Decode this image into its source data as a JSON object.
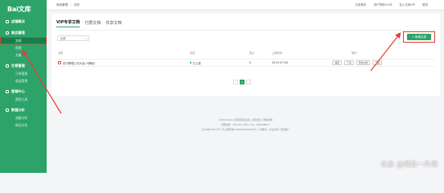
{
  "sidebar": {
    "logo_text": "Bai文库",
    "groups": [
      {
        "label": "店铺概况",
        "items": []
      },
      {
        "label": "商品管理",
        "items": [
          "文档",
          "视频",
          "文集"
        ]
      },
      {
        "label": "交易管理",
        "items": [
          "订单管理",
          "收益管理"
        ]
      },
      {
        "label": "营销中心",
        "items": [
          "营销工具"
        ]
      },
      {
        "label": "数据分析",
        "items": [
          "流量分析",
          "商品分析"
        ]
      }
    ]
  },
  "topbar": {
    "crumb_1": "商品管理",
    "crumb_sep": "/",
    "crumb_2": "文档",
    "right_links": [
      "文库首页",
      "用户帮助1018",
      "加入文库VIP",
      "登录"
    ]
  },
  "tabs": [
    "VIP专享文档",
    "付费文档",
    "共享文档"
  ],
  "filter": {
    "value": "全部",
    "caret": "▾"
  },
  "new_doc_button": "+ 新增文档",
  "table": {
    "headers": [
      "名称",
      "状态",
      "售价",
      "上架时间",
      "操作"
    ],
    "rows": [
      {
        "icon": "PDF",
        "name": "初中物理公式大全(人教版)",
        "status": "已上架",
        "count": "0",
        "date": "2019-07-06",
        "actions": [
          "编辑",
          "下架",
          "修改价格",
          "下载"
        ]
      }
    ]
  },
  "pager": {
    "prev": "‹",
    "current": "1",
    "next": "›"
  },
  "footer": {
    "line1": "©2019 Baidu 使用百度前必读 | 文库协议 | 网站地图",
    "line2": "客服电话：400-921-7000  |  QQ：800048815",
    "line3": "京ICP证030173号 | 京公网安备11000002000001号 | 广告服务 | 企业文库 | 百度推广"
  },
  "watermark": "头条 @城北一片海",
  "colors": {
    "brand": "#2da36a",
    "highlight": "#e83b2f"
  }
}
